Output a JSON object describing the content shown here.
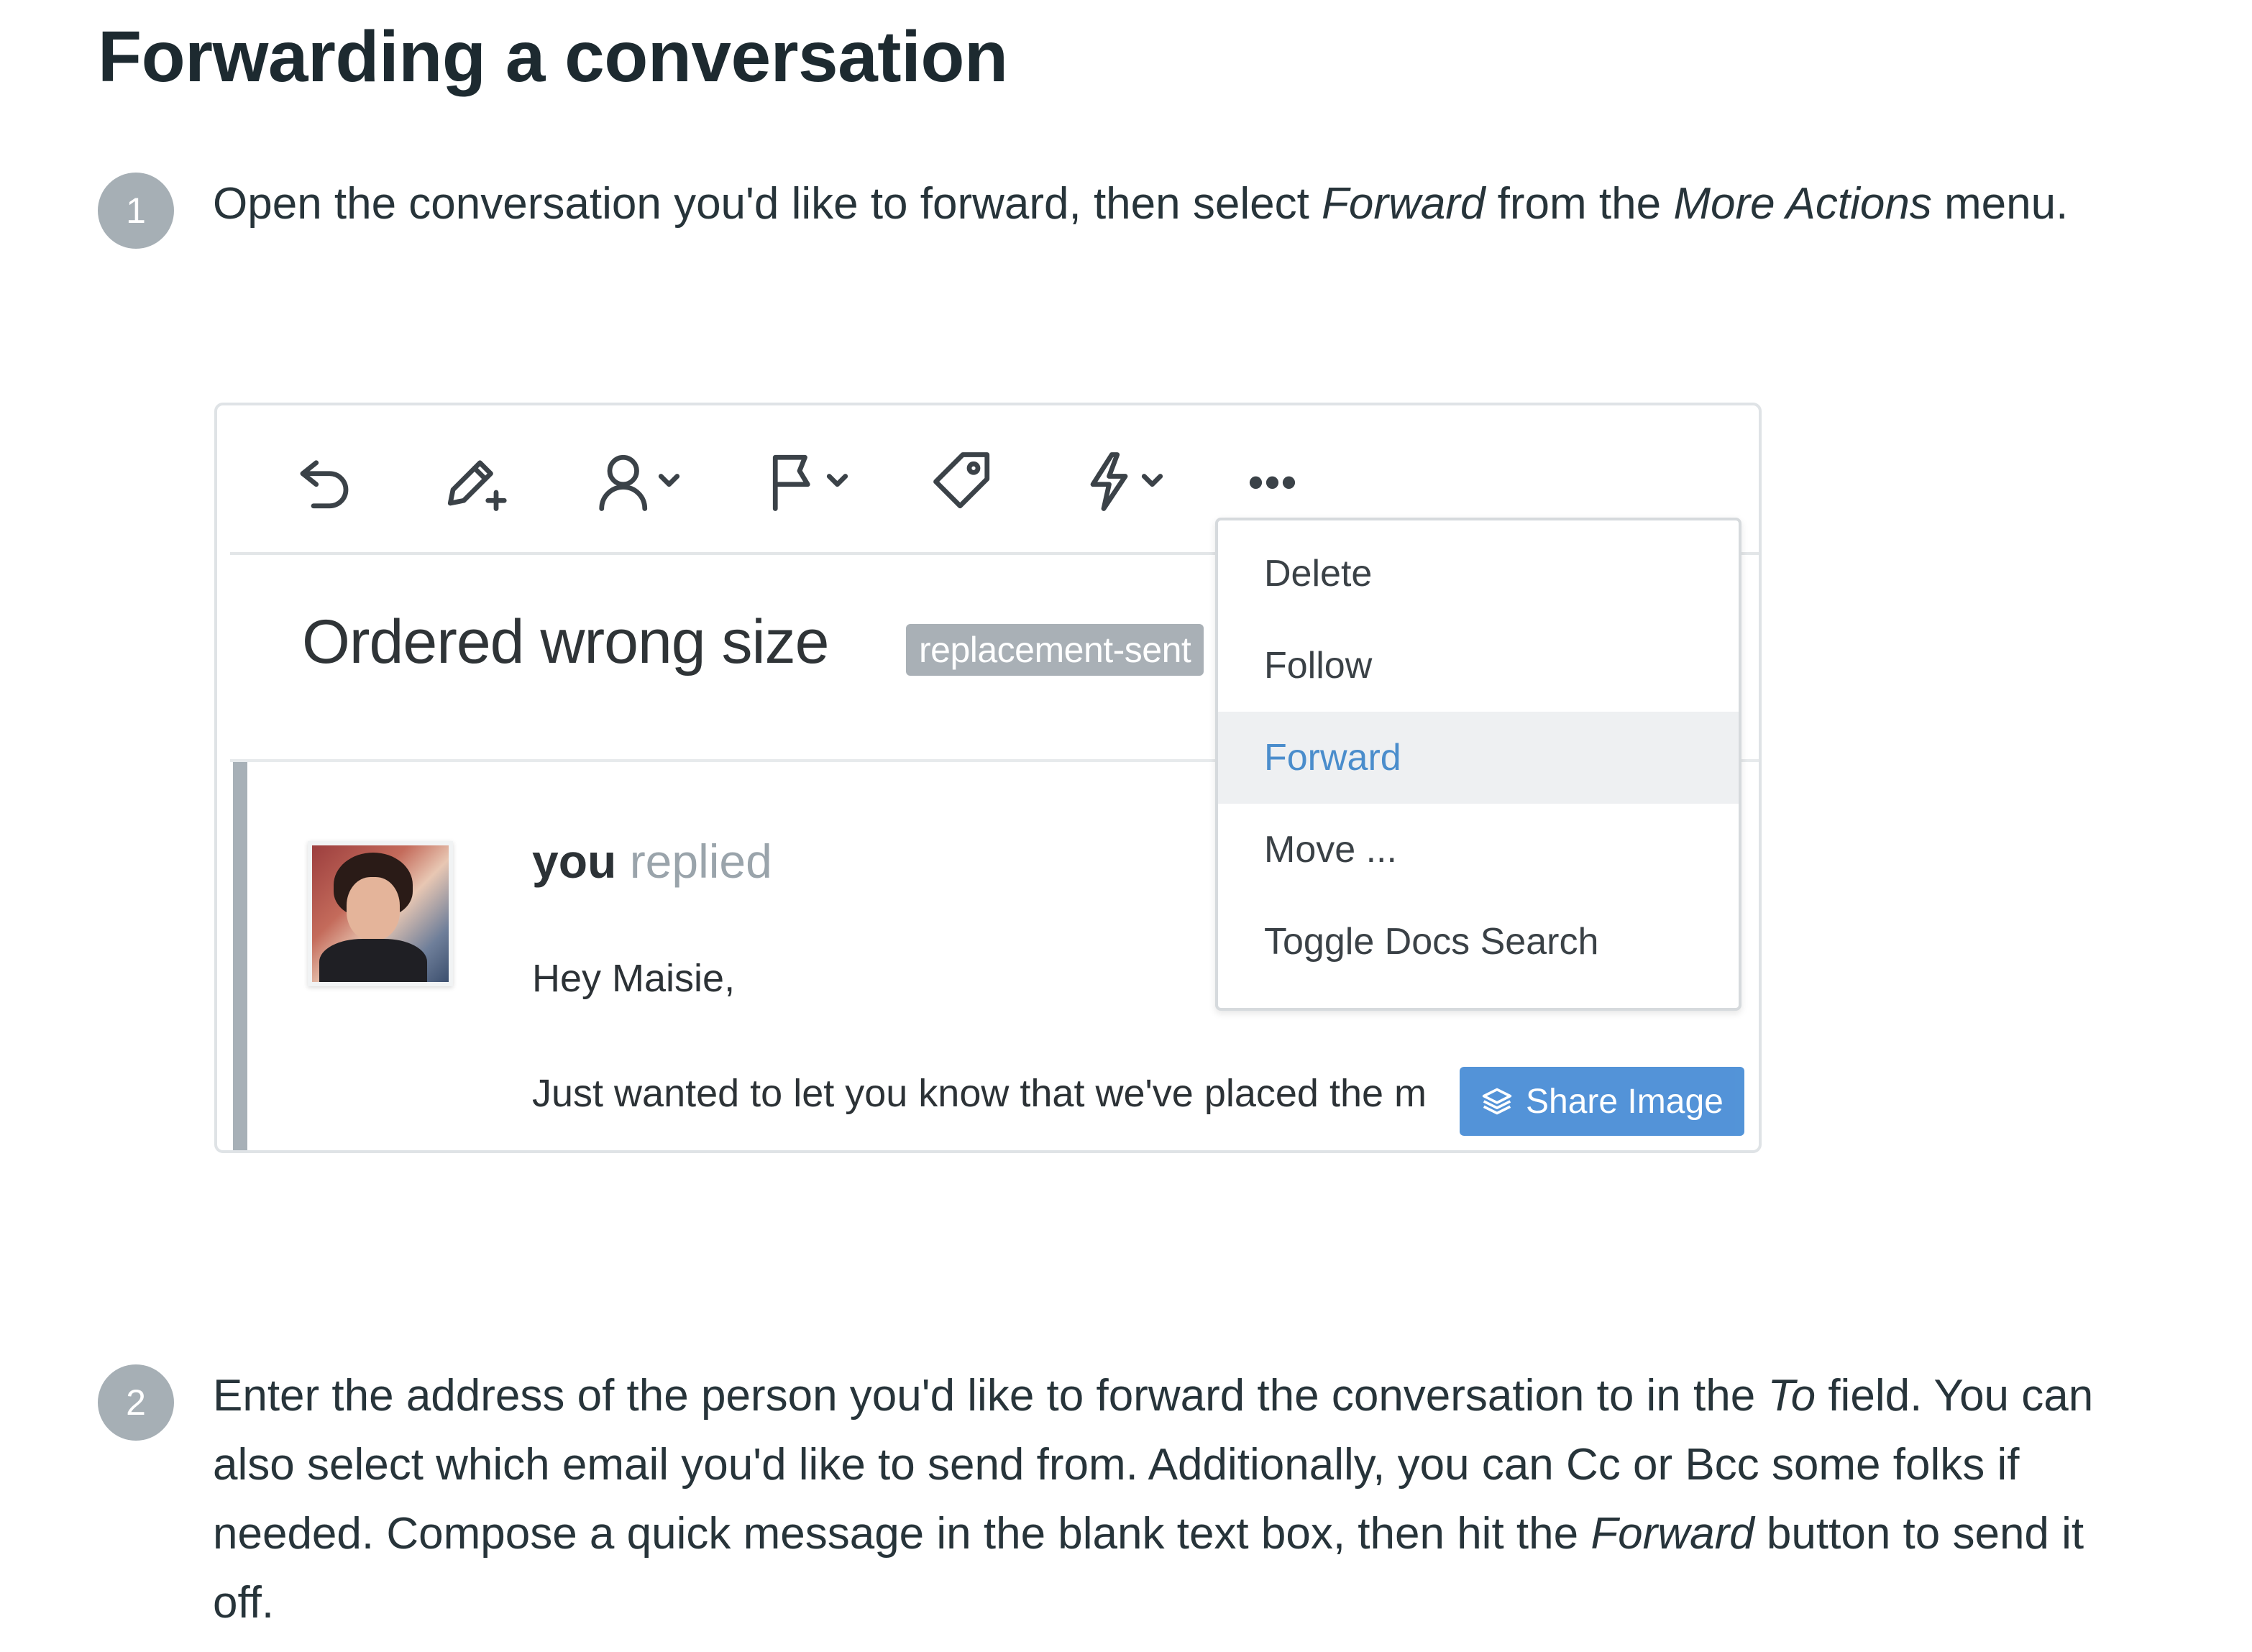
{
  "title": "Forwarding a conversation",
  "steps": [
    {
      "number": "1",
      "text_parts": [
        "Open the conversation you'd like to forward, then select ",
        "Forward",
        " from the ",
        "More Actions",
        " menu."
      ]
    },
    {
      "number": "2",
      "text_parts": [
        "Enter the address of the person you'd like to forward the conversation to in the ",
        "To",
        " field. You can also select which email you'd like to send from. Additionally, you can Cc or Bcc some folks if needed. Compose a quick message in the blank text box, then hit the ",
        "Forward",
        " button to send it off."
      ]
    }
  ],
  "screenshot": {
    "toolbar_icons": [
      "undo-icon",
      "edit-plus-icon",
      "user-dropdown-icon",
      "flag-dropdown-icon",
      "tag-icon",
      "lightning-dropdown-icon",
      "more-actions-icon"
    ],
    "more_dots": "•••",
    "subject": "Ordered wrong size",
    "tag": "replacement-sent",
    "reply_who": "you",
    "reply_action": "replied",
    "greeting": "Hey Maisie,",
    "body_line": "Just wanted to let you know that we've placed the m",
    "menu_items": [
      "Delete",
      "Follow",
      "Forward",
      "Move ...",
      "Toggle Docs Search"
    ],
    "menu_active": "Forward",
    "share_button": "Share Image",
    "colors": {
      "accent_blue": "#4a8ed6",
      "active_text": "#4a8dcc",
      "badge_gray": "#a6afb5"
    }
  }
}
